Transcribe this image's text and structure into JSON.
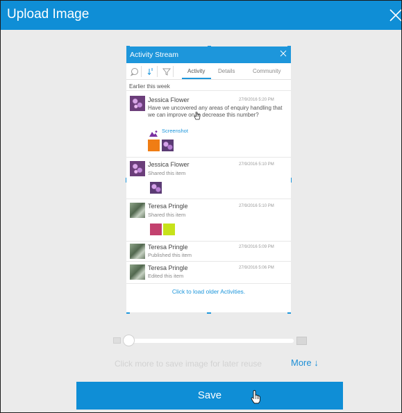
{
  "dialog": {
    "title": "Upload Image",
    "close_icon": "close-icon"
  },
  "preview": {
    "header_title": "Activity Stream",
    "tabs": [
      {
        "label": "Activity"
      },
      {
        "label": "Details"
      },
      {
        "label": "Community"
      }
    ],
    "section_label": "Earlier this week",
    "entries": [
      {
        "name": "Jessica Flower",
        "timestamp": "27/9/2016 5:20 PM",
        "message": "Have we uncovered any areas of enquiry handling that we can improve on to decrease this number?",
        "link": "Screenshot"
      },
      {
        "name": "Jessica Flower",
        "timestamp": "27/9/2016 5:10 PM",
        "subtext": "Shared this item"
      },
      {
        "name": "Teresa Pringle",
        "timestamp": "27/9/2016 5:10 PM",
        "subtext": "Shared this item"
      },
      {
        "name": "Teresa Pringle",
        "timestamp": "27/9/2016 5:09 PM",
        "subtext": "Published this item"
      },
      {
        "name": "Teresa Pringle",
        "timestamp": "27/9/2016 5:06 PM",
        "subtext": "Edited this item"
      }
    ],
    "load_more": "Click to load older Activities."
  },
  "zoom": {
    "level": 0
  },
  "footer": {
    "hint": "Click more to save image for later reuse",
    "more_label": "More",
    "more_arrow": "↓",
    "save_label": "Save"
  },
  "colors": {
    "accent": "#0f8ed6",
    "preview_accent": "#1d96db",
    "backdrop": "#ebebeb"
  }
}
